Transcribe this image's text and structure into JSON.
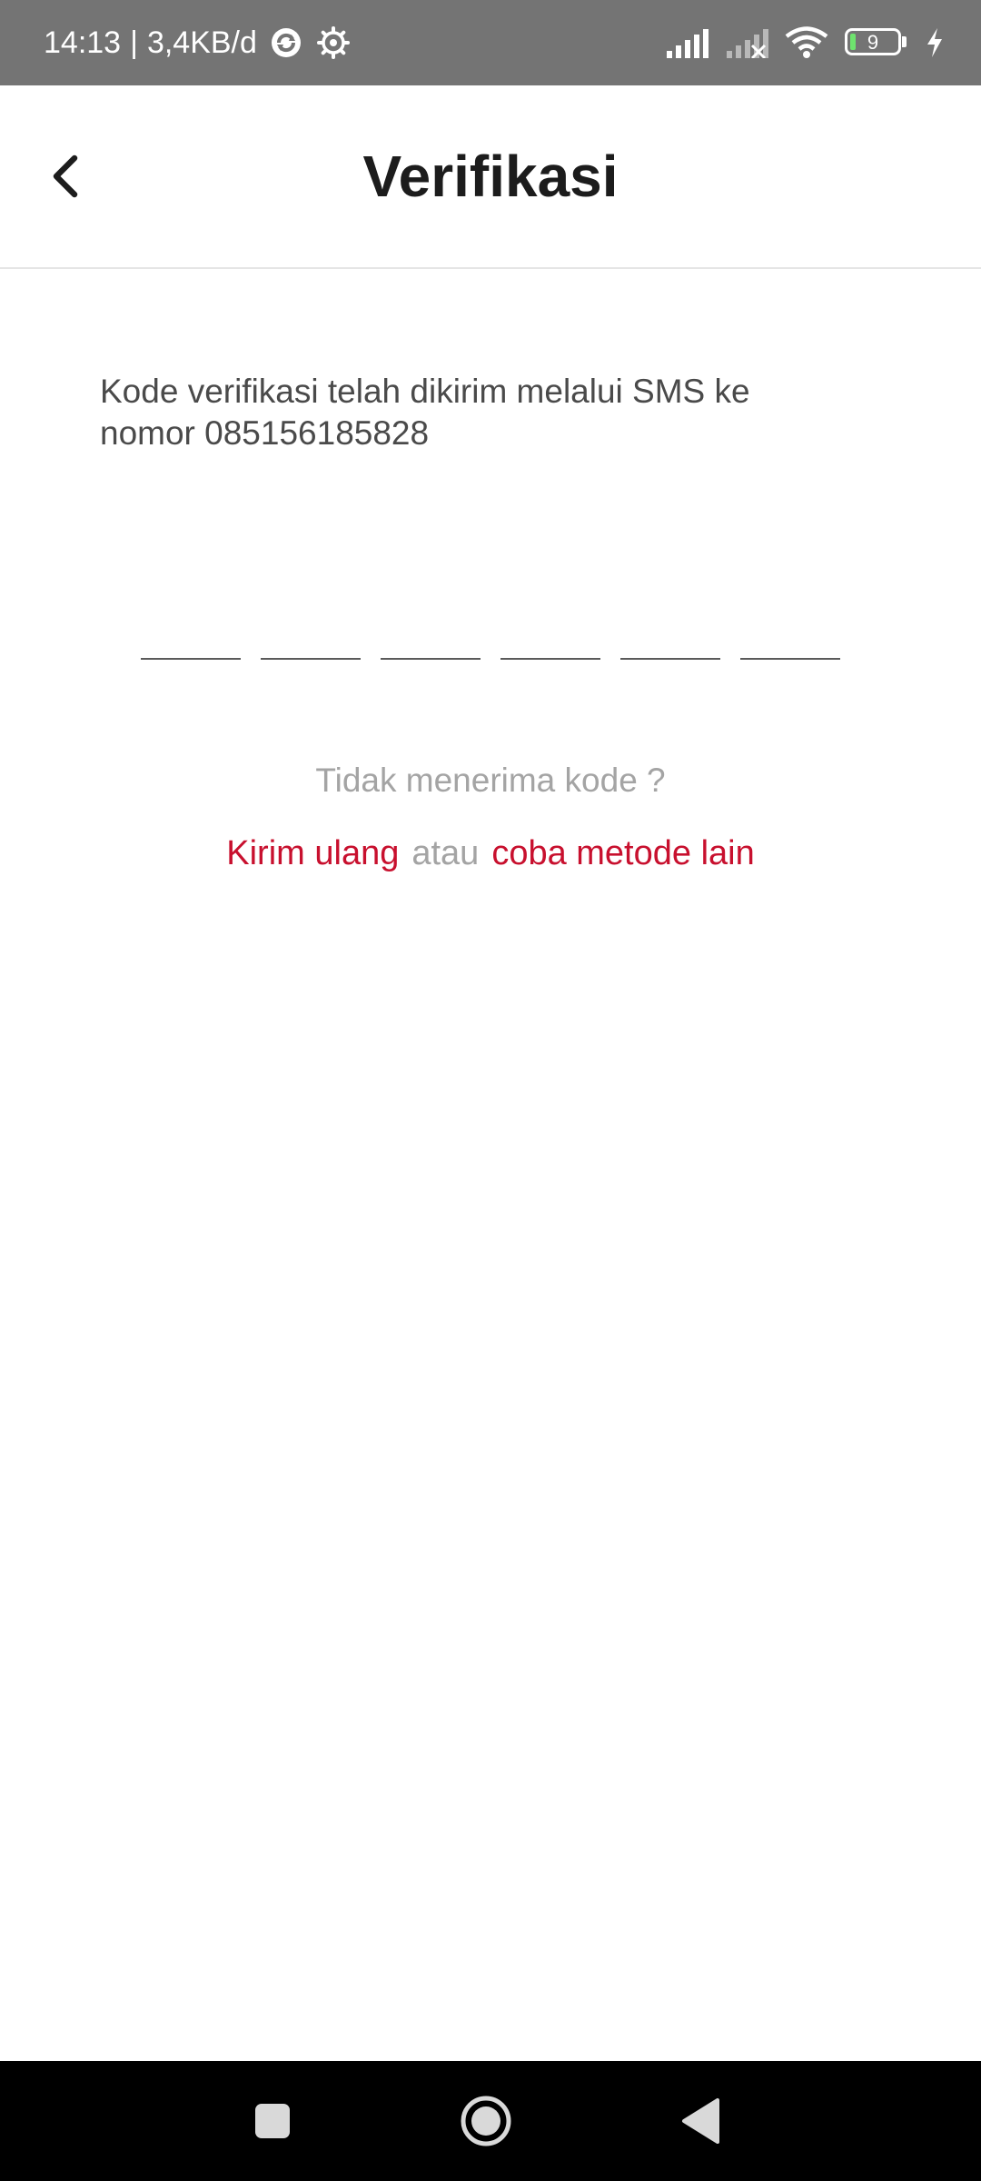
{
  "status_bar": {
    "time": "14:13",
    "separator": "|",
    "network_speed": "3,4KB/d",
    "battery_level": "9",
    "icons": [
      "sync-icon",
      "gear-icon",
      "signal-icon",
      "signal-no-service-icon",
      "wifi-icon",
      "battery-icon",
      "charging-icon"
    ]
  },
  "header": {
    "title": "Verifikasi",
    "back_icon": "chevron-left-icon"
  },
  "content": {
    "description": "Kode verifikasi telah dikirim melalui SMS ke nomor 085156185828",
    "otp": {
      "length": 6,
      "values": [
        "",
        "",
        "",
        "",
        "",
        ""
      ]
    },
    "not_received_text": "Tidak menerima kode ?",
    "resend_label": "Kirim ulang",
    "or_label": "atau",
    "other_method_label": "coba metode lain"
  },
  "colors": {
    "accent": "#c8102e",
    "muted_text": "#a4a4a4",
    "body_text": "#4a4a4a",
    "status_bar": "#747474"
  },
  "nav_bar": {
    "icons": [
      "recents-square-icon",
      "home-circle-icon",
      "back-triangle-icon"
    ]
  }
}
